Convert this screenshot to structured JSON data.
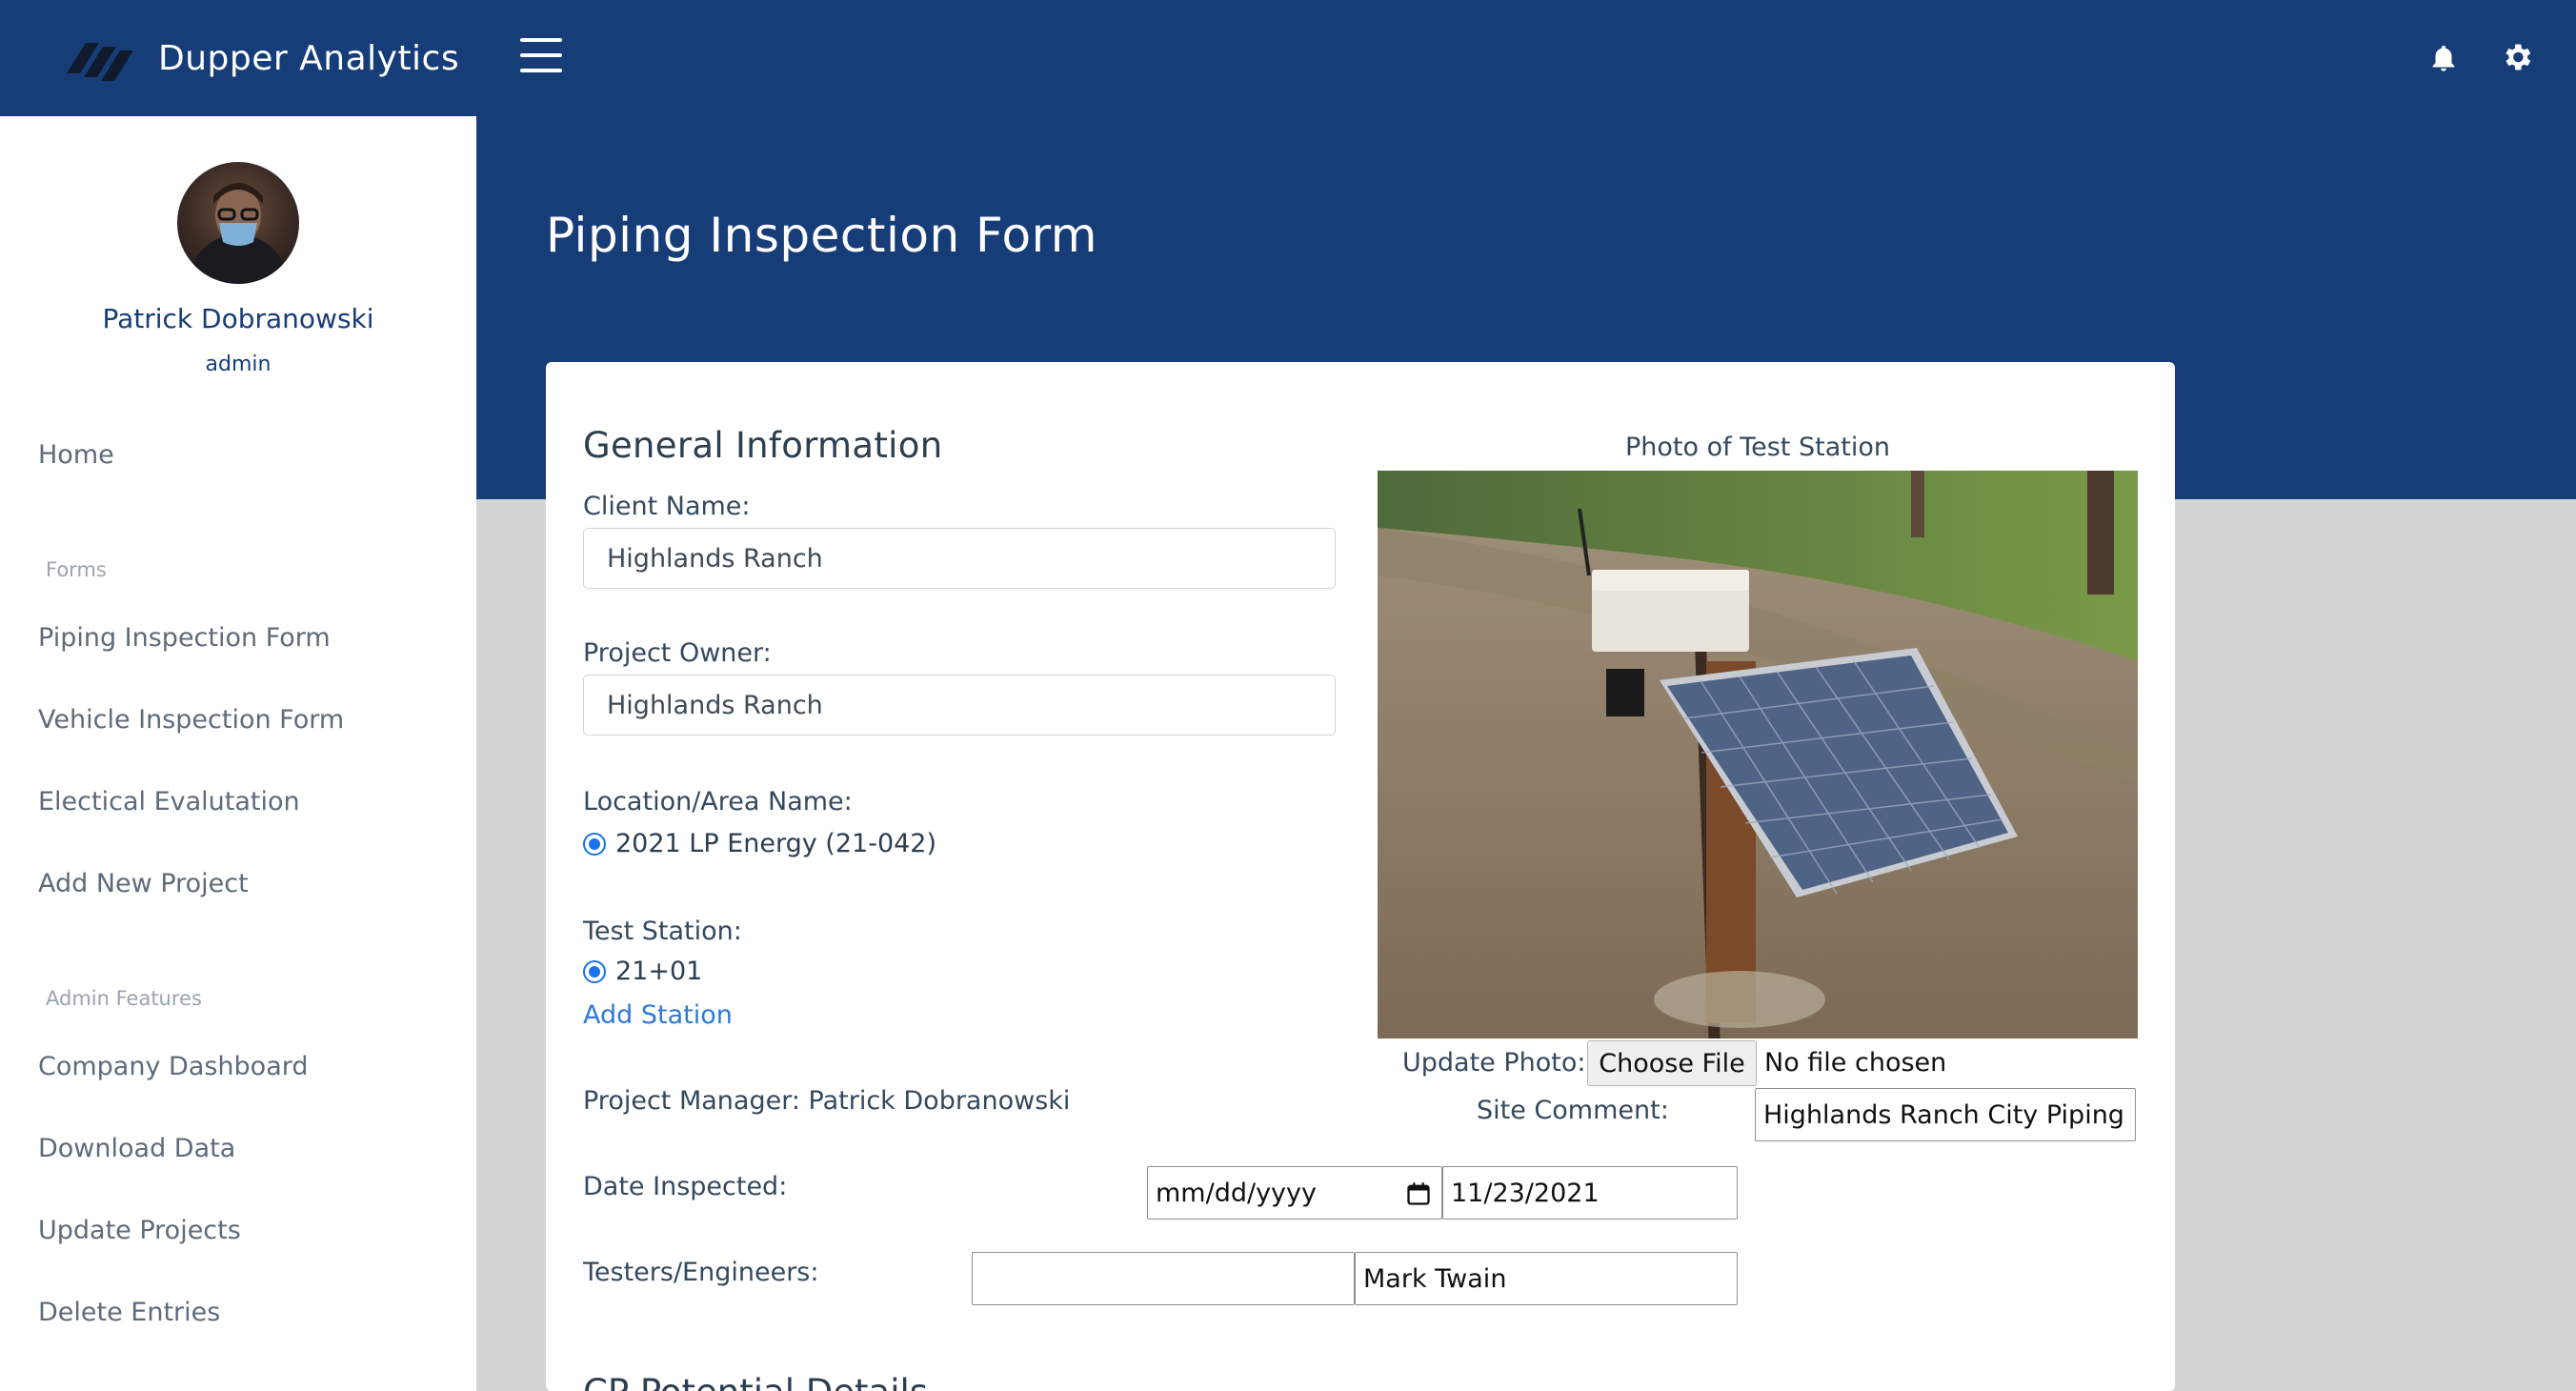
{
  "app": {
    "brand_name": "Dupper Analytics",
    "colors": {
      "primary": "#173d79",
      "accent": "#2f7ad6",
      "page_bg": "#d3d3d3"
    }
  },
  "header": {
    "icons": [
      "menu-icon",
      "bell-icon",
      "gear-icon"
    ]
  },
  "user": {
    "name": "Patrick Dobranowski",
    "role": "admin"
  },
  "sidebar": {
    "home": "Home",
    "forms_section": "Forms",
    "forms": [
      "Piping Inspection Form",
      "Vehicle Inspection Form",
      "Electical Evalutation",
      "Add New Project"
    ],
    "admin_section": "Admin Features",
    "admin": [
      "Company Dashboard",
      "Download Data",
      "Update Projects",
      "Delete Entries"
    ]
  },
  "page": {
    "title": "Piping Inspection Form"
  },
  "form": {
    "section_title": "General Information",
    "client_name_label": "Client Name:",
    "client_name_value": "Highlands Ranch",
    "project_owner_label": "Project Owner:",
    "project_owner_value": "Highlands Ranch",
    "location_label": "Location/Area Name:",
    "location_option": "2021 LP Energy (21-042)",
    "test_station_label": "Test Station:",
    "test_station_option": "21+01",
    "add_station_link": "Add Station",
    "project_manager_text": "Project Manager: Patrick Dobranowski",
    "photo_caption": "Photo of Test Station",
    "update_photo_label": "Update Photo:",
    "choose_file_button": "Choose File",
    "no_file_text": "No file chosen",
    "site_comment_label": "Site Comment:",
    "site_comment_value": "Highlands Ranch City Piping",
    "date_inspected_label": "Date Inspected:",
    "date_placeholder": "mm/dd/yyyy",
    "date_value": "11/23/2021",
    "testers_label": "Testers/Engineers:",
    "testers_value_1": "",
    "testers_value_2": "Mark Twain",
    "next_section_title": "CP Potential Details"
  }
}
